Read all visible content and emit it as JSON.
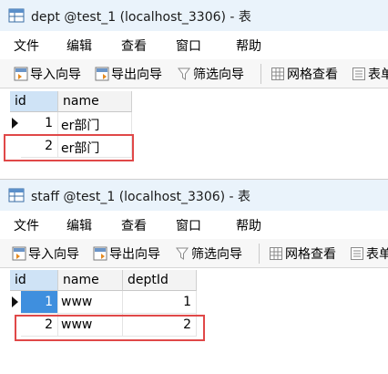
{
  "windows": [
    {
      "title": "dept @test_1 (localhost_3306) - 表",
      "menu": [
        "文件",
        "编辑",
        "查看",
        "窗口",
        "帮助"
      ],
      "toolbar": [
        "导入向导",
        "导出向导",
        "筛选向导",
        "网格查看",
        "表单"
      ],
      "columns": [
        "id",
        "name"
      ],
      "rows": [
        [
          "1",
          "er部门"
        ],
        [
          "2",
          "er部门"
        ]
      ]
    },
    {
      "title": "staff @test_1 (localhost_3306) - 表",
      "menu": [
        "文件",
        "编辑",
        "查看",
        "窗口",
        "帮助"
      ],
      "toolbar": [
        "导入向导",
        "导出向导",
        "筛选向导",
        "网格查看",
        "表单"
      ],
      "columns": [
        "id",
        "name",
        "deptId"
      ],
      "rows": [
        [
          "1",
          "www",
          "1"
        ],
        [
          "2",
          "www",
          "2"
        ]
      ]
    }
  ],
  "colors": {
    "title_bg": "#eaf3fb",
    "selection_blue": "#3f8fde",
    "header_selected": "#cfe3f6",
    "highlight_red": "#e04848"
  },
  "icons": [
    "table-icon",
    "import-icon",
    "export-icon",
    "filter-icon",
    "grid-view-icon",
    "form-view-icon",
    "current-row-arrow-icon"
  ]
}
